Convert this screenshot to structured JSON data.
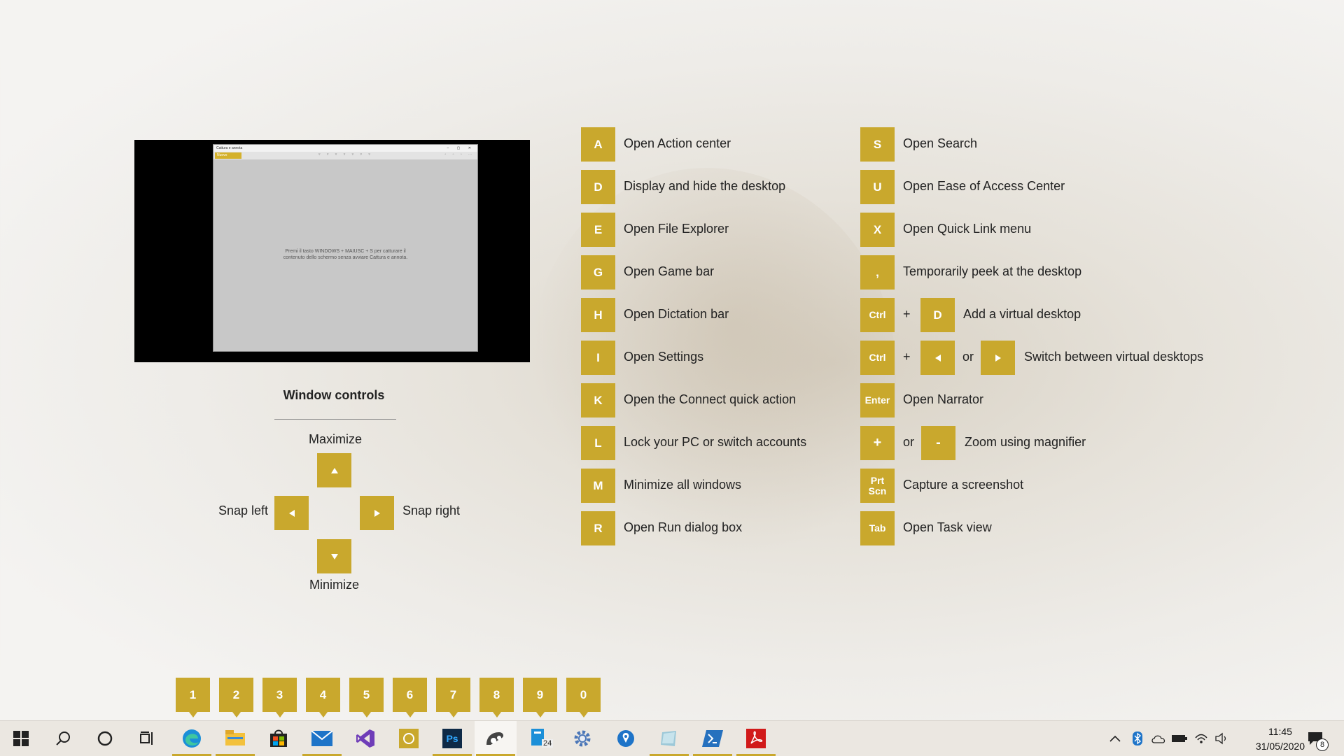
{
  "preview": {
    "window_title": "Cattura e annota",
    "new_label": "Nuovo",
    "body_text_1": "Premi il tasto WINDOWS + MAIUSC + S per catturare il",
    "body_text_2": "contenuto dello schermo senza avviare Cattura e annota."
  },
  "window_controls": {
    "title": "Window controls",
    "maximize": "Maximize",
    "minimize": "Minimize",
    "snap_left": "Snap left",
    "snap_right": "Snap right"
  },
  "shortcuts_left": [
    {
      "key": "A",
      "label": "Open Action center"
    },
    {
      "key": "D",
      "label": "Display and hide the desktop"
    },
    {
      "key": "E",
      "label": "Open File Explorer"
    },
    {
      "key": "G",
      "label": "Open Game bar"
    },
    {
      "key": "H",
      "label": "Open Dictation bar"
    },
    {
      "key": "I",
      "label": "Open Settings"
    },
    {
      "key": "K",
      "label": "Open the Connect quick action"
    },
    {
      "key": "L",
      "label": "Lock your PC or switch accounts"
    },
    {
      "key": "M",
      "label": "Minimize all windows"
    },
    {
      "key": "R",
      "label": "Open Run dialog box"
    }
  ],
  "shortcuts_right": {
    "s": {
      "key": "S",
      "label": "Open Search"
    },
    "u": {
      "key": "U",
      "label": "Open Ease of Access Center"
    },
    "x": {
      "key": "X",
      "label": "Open Quick Link menu"
    },
    "comma": {
      "key": ",",
      "label": "Temporarily peek at the desktop"
    },
    "ctrl_d": {
      "key1": "Ctrl",
      "plus": "+",
      "key2": "D",
      "label": "Add a virtual desktop"
    },
    "ctrl_arrows": {
      "key1": "Ctrl",
      "plus": "+",
      "or": "or",
      "label": "Switch between virtual desktops"
    },
    "enter": {
      "key": "Enter",
      "label": "Open Narrator"
    },
    "zoom": {
      "key1": "+",
      "or": "or",
      "key2": "-",
      "label": "Zoom using magnifier"
    },
    "prtscn": {
      "key_line1": "Prt",
      "key_line2": "Scn",
      "label": "Capture a screenshot"
    },
    "tab": {
      "key": "Tab",
      "label": "Open Task view"
    }
  },
  "number_keys": [
    "1",
    "2",
    "3",
    "4",
    "5",
    "6",
    "7",
    "8",
    "9",
    "0"
  ],
  "taskbar": {
    "apps": [
      {
        "icon": "windows-start-icon"
      },
      {
        "icon": "search-icon"
      },
      {
        "icon": "cortana-icon"
      },
      {
        "icon": "task-view-icon"
      },
      {
        "icon": "edge-icon"
      },
      {
        "icon": "file-explorer-icon"
      },
      {
        "icon": "store-icon"
      },
      {
        "icon": "mail-icon"
      },
      {
        "icon": "visual-studio-icon"
      },
      {
        "icon": "whatsapp-icon"
      },
      {
        "icon": "photoshop-icon"
      },
      {
        "icon": "snip-sketch-icon"
      },
      {
        "icon": "files-icon"
      },
      {
        "icon": "settings-gear-icon"
      },
      {
        "icon": "maps-icon"
      },
      {
        "icon": "app-icon"
      },
      {
        "icon": "powershell-icon"
      },
      {
        "icon": "acrobat-icon"
      }
    ],
    "ps_label": "Ps",
    "files_badge": "24",
    "time": "11:45",
    "date": "31/05/2020",
    "notification_count": "8",
    "accent": "#c9a82d"
  }
}
